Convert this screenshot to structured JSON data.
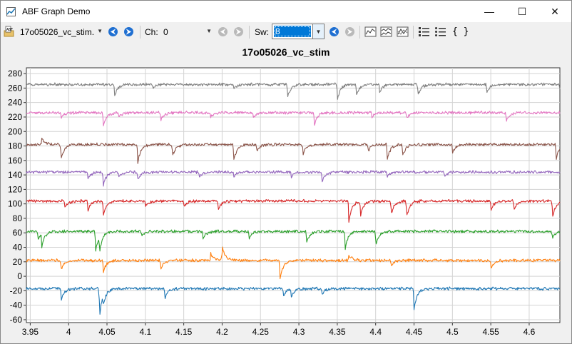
{
  "window": {
    "title": "ABF Graph Demo",
    "minimize": "—",
    "maximize": "☐",
    "close": "✕"
  },
  "toolbar": {
    "file_combo": "17o05026_vc_stim.",
    "ch_label": "Ch:",
    "ch_value": "0",
    "sw_label": "Sw:",
    "sw_value": "8",
    "braces": "{ }"
  },
  "icons": [
    "file-open-icon",
    "back-icon",
    "forward-icon",
    "graph-icon",
    "graph-stacked-icon",
    "graph-overlay-icon",
    "list-details-icon",
    "list-icon"
  ],
  "chart_data": {
    "type": "line",
    "title": "17o05026_vc_stim",
    "xlabel": "",
    "ylabel": "",
    "xlim": [
      3.945,
      4.64
    ],
    "ylim": [
      -64,
      288
    ],
    "x_ticks": [
      "3.95",
      "4",
      "4.05",
      "4.1",
      "4.15",
      "4.2",
      "4.25",
      "4.3",
      "4.35",
      "4.4",
      "4.45",
      "4.5",
      "4.55",
      "4.6"
    ],
    "y_ticks": [
      "-60",
      "-40",
      "-20",
      "0",
      "20",
      "40",
      "60",
      "80",
      "100",
      "120",
      "140",
      "160",
      "180",
      "200",
      "220",
      "240",
      "260",
      "280"
    ],
    "grid": true,
    "series": [
      {
        "color": "#1f77b4",
        "baseline": -17,
        "events": [
          [
            3.99,
            -18
          ],
          [
            4.04,
            -42
          ],
          [
            4.045,
            -12
          ],
          [
            4.125,
            -15
          ],
          [
            4.28,
            -10
          ],
          [
            4.29,
            -12
          ],
          [
            4.33,
            -8
          ],
          [
            4.45,
            -30
          ]
        ]
      },
      {
        "color": "#ff7f0e",
        "baseline": 22,
        "events": [
          [
            3.99,
            -14
          ],
          [
            4.045,
            -18
          ],
          [
            4.12,
            -12
          ],
          [
            4.185,
            10
          ],
          [
            4.2,
            20
          ],
          [
            4.275,
            -30
          ],
          [
            4.365,
            8
          ],
          [
            4.42,
            -8
          ],
          [
            4.55,
            -12
          ]
        ]
      },
      {
        "color": "#2ca02c",
        "baseline": 62,
        "events": [
          [
            3.96,
            -12
          ],
          [
            3.965,
            -18
          ],
          [
            4.035,
            -30
          ],
          [
            4.04,
            -22
          ],
          [
            4.095,
            -8
          ],
          [
            4.175,
            -10
          ],
          [
            4.235,
            -10
          ],
          [
            4.31,
            -16
          ],
          [
            4.36,
            -26
          ],
          [
            4.4,
            -20
          ],
          [
            4.63,
            -10
          ]
        ]
      },
      {
        "color": "#d62728",
        "baseline": 104,
        "events": [
          [
            3.995,
            -10
          ],
          [
            4.025,
            -14
          ],
          [
            4.045,
            -22
          ],
          [
            4.1,
            -8
          ],
          [
            4.15,
            -8
          ],
          [
            4.195,
            -12
          ],
          [
            4.365,
            -30
          ],
          [
            4.38,
            -22
          ],
          [
            4.42,
            -20
          ],
          [
            4.44,
            -24
          ],
          [
            4.55,
            -14
          ],
          [
            4.58,
            -14
          ],
          [
            4.63,
            -26
          ]
        ]
      },
      {
        "color": "#9467bd",
        "baseline": 144,
        "events": [
          [
            4.025,
            -10
          ],
          [
            4.045,
            -20
          ],
          [
            4.065,
            -8
          ],
          [
            4.09,
            -10
          ],
          [
            4.17,
            -8
          ],
          [
            4.215,
            -6
          ],
          [
            4.29,
            -8
          ],
          [
            4.33,
            -14
          ],
          [
            4.415,
            -6
          ],
          [
            4.49,
            -6
          ]
        ]
      },
      {
        "color": "#8c564b",
        "baseline": 182,
        "events": [
          [
            3.965,
            10
          ],
          [
            3.99,
            -22
          ],
          [
            4.09,
            -26
          ],
          [
            4.135,
            -18
          ],
          [
            4.215,
            -24
          ],
          [
            4.245,
            -10
          ],
          [
            4.305,
            -16
          ],
          [
            4.39,
            -10
          ],
          [
            4.415,
            -22
          ],
          [
            4.435,
            -16
          ],
          [
            4.5,
            -12
          ],
          [
            4.635,
            -22
          ]
        ]
      },
      {
        "color": "#e377c2",
        "baseline": 226,
        "events": [
          [
            3.99,
            -8
          ],
          [
            4.045,
            -20
          ],
          [
            4.065,
            -8
          ],
          [
            4.12,
            -10
          ],
          [
            4.185,
            -6
          ],
          [
            4.24,
            -8
          ],
          [
            4.32,
            -18
          ],
          [
            4.395,
            -6
          ],
          [
            4.44,
            -8
          ],
          [
            4.57,
            -12
          ]
        ]
      },
      {
        "color": "#7f7f7f",
        "baseline": 265,
        "events": [
          [
            4.06,
            -16
          ],
          [
            4.11,
            -6
          ],
          [
            4.215,
            -6
          ],
          [
            4.285,
            -20
          ],
          [
            4.35,
            -22
          ],
          [
            4.375,
            -16
          ],
          [
            4.405,
            -12
          ],
          [
            4.455,
            -16
          ],
          [
            4.545,
            -12
          ],
          [
            4.64,
            -8
          ]
        ]
      }
    ]
  }
}
